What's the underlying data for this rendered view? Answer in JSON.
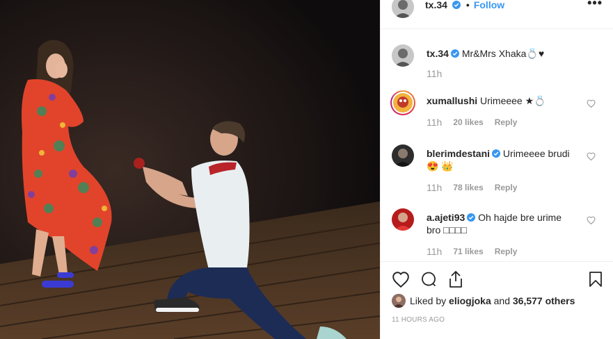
{
  "post": {
    "owner": "tx.34",
    "separator": "•",
    "follow_label": "Follow",
    "more_label": "•••"
  },
  "comments": [
    {
      "username": "tx.34",
      "text": "Mr&Mrs Xhaka💍♥",
      "time": "11h",
      "likes": "",
      "reply": "",
      "verified": true
    },
    {
      "username": "xumallushi",
      "text": "Urimeeee ★💍",
      "time": "11h",
      "likes": "20 likes",
      "reply": "Reply",
      "verified": false
    },
    {
      "username": "blerimdestani",
      "text": "Urimeeee brudi",
      "text2": "😍 👑",
      "time": "11h",
      "likes": "78 likes",
      "reply": "Reply",
      "verified": true
    },
    {
      "username": "a.ajeti93",
      "text": "Oh hajde bre urime",
      "text2": "bro □□□□",
      "time": "11h",
      "likes": "71 likes",
      "reply": "Reply",
      "verified": true
    }
  ],
  "likes": {
    "prefix": "Liked by ",
    "user": "eliogjoka",
    "middle": " and ",
    "count": "36,577 others"
  },
  "timestamp": "11 HOURS AGO",
  "colors": {
    "accent": "#3897f0",
    "verified": "#3897f0",
    "muted": "#999999",
    "text": "#262626"
  },
  "icons": [
    "heart-icon",
    "comment-icon",
    "share-icon",
    "bookmark-icon",
    "verified-icon",
    "more-icon"
  ]
}
